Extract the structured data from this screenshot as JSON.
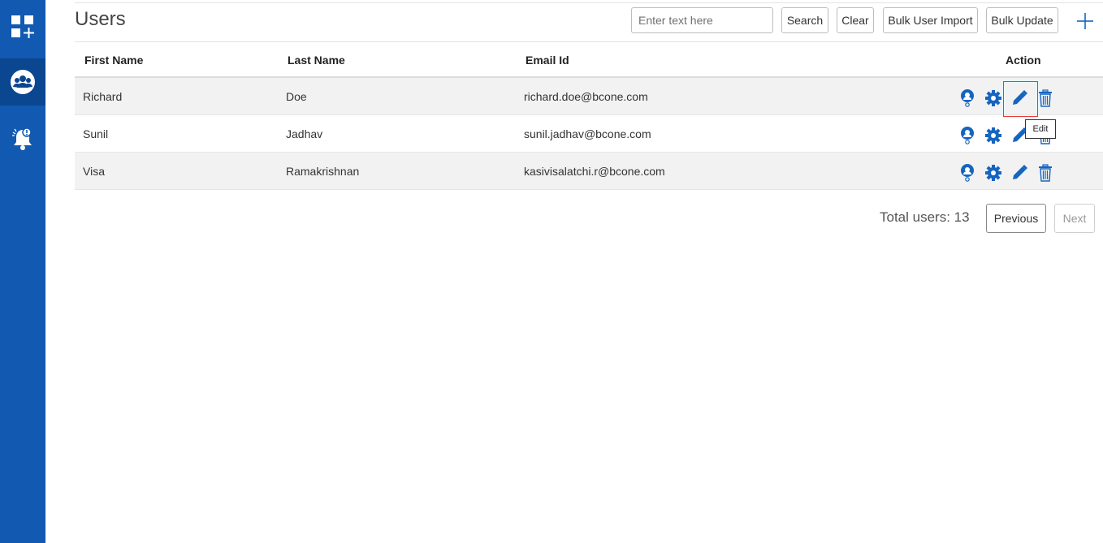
{
  "sidebar": {
    "items": [
      {
        "name": "apps",
        "icon": "apps-add-icon"
      },
      {
        "name": "users",
        "icon": "users-group-icon",
        "active": true
      },
      {
        "name": "alerts",
        "icon": "bell-alert-icon"
      }
    ],
    "colors": {
      "background": "#1159b1",
      "active": "#0b4690"
    }
  },
  "header": {
    "title": "Users",
    "search_placeholder": "Enter text here",
    "search_value": "",
    "search_label": "Search",
    "clear_label": "Clear",
    "bulk_import_label": "Bulk User Import",
    "bulk_update_label": "Bulk Update",
    "add_icon": "plus-icon"
  },
  "table": {
    "columns": [
      "First Name",
      "Last Name",
      "Email Id",
      "Action"
    ],
    "rows": [
      {
        "first": "Richard",
        "last": "Doe",
        "email": "richard.doe@bcone.com"
      },
      {
        "first": "Sunil",
        "last": "Jadhav",
        "email": "sunil.jadhav@bcone.com"
      },
      {
        "first": "Visa",
        "last": "Ramakrishnan",
        "email": "kasivisalatchi.r@bcone.com"
      }
    ],
    "action_icons": [
      "user-role-icon",
      "gear-icon",
      "pencil-icon",
      "trash-icon"
    ],
    "accent_color": "#1565c0"
  },
  "tooltip": {
    "text": "Edit"
  },
  "footer": {
    "total_label": "Total users: 13",
    "previous_label": "Previous",
    "next_label": "Next"
  }
}
